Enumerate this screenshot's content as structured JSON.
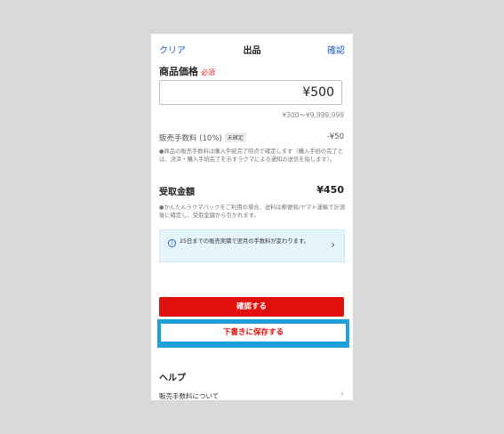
{
  "nav": {
    "left": "クリア",
    "title": "出品",
    "right": "確認"
  },
  "price": {
    "label": "商品価格",
    "required": "必須",
    "value": "¥500",
    "range": "¥300～¥9,999,999"
  },
  "fee": {
    "label": "販売手数料 (10%)",
    "badge": "未確定",
    "value": "-¥50",
    "note": "●商品の販売手数料は購入手続完了時点で確定します（購入手続の完了とは、決済・購入手続完了を示すラクマによる通知の送信を指します）。"
  },
  "receive": {
    "label": "受取金額",
    "value": "¥450",
    "note": "●かんたんラクマパックをご利用の場合、送料は郵便局/ヤマト運輸で計測後に確定し、受取金額から引かれます。"
  },
  "info": {
    "icon": "i",
    "text": "25日までの販売実績で翌月の手数料が変わります。"
  },
  "actions": {
    "confirm": "確認する",
    "save_draft": "下書きに保存する"
  },
  "help": {
    "title": "ヘルプ",
    "item": "販売手数料について"
  },
  "colors": {
    "accent_red": "#e0100c",
    "link_blue": "#1f5fbf",
    "highlight": "#1fa0d8"
  }
}
